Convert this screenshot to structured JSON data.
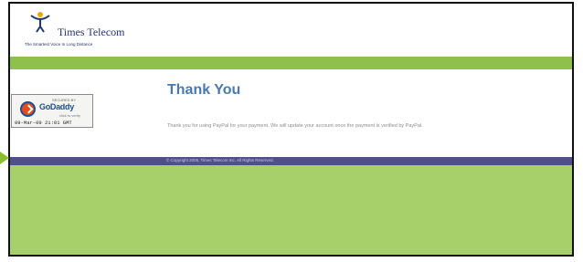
{
  "brand": {
    "name": "Times Telecom",
    "tagline": "The Smartest Voice In Long Distance"
  },
  "seal": {
    "secured_by": "SECURED BY",
    "brand": "GoDaddy",
    "verify": "click to verify",
    "date": "09-Mar-09 21:01 GMT",
    "colors": {
      "ring": "#e24d20",
      "brand": "#1d4f8c"
    }
  },
  "main": {
    "heading": "Thank You",
    "message": "Thank you for using PayPal for your payment. We will update your account once the payment is verified by PayPal."
  },
  "footer": {
    "copyright": "© Copyright 2005, Times Telecom Inc. All Rights Reserved."
  },
  "colors": {
    "background_green": "#a7cf6a",
    "band_green": "#8fc04c",
    "footer_purple": "#4f4f8c",
    "heading_blue": "#4a7aad"
  }
}
